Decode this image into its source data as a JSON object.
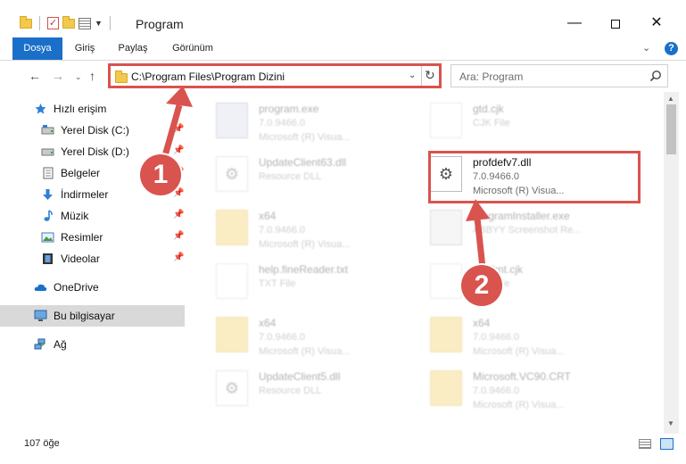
{
  "window": {
    "title": "Program",
    "minimize_glyph": "—",
    "close_glyph": "✕"
  },
  "ribbon": {
    "tabs": [
      {
        "label": "Dosya"
      },
      {
        "label": "Giriş"
      },
      {
        "label": "Paylaş"
      },
      {
        "label": "Görünüm"
      }
    ],
    "help_glyph": "?"
  },
  "navigation": {
    "address_path": "C:\\Program Files\\Program Dizini",
    "search_placeholder": "Ara: Program"
  },
  "sidebar": {
    "items": [
      {
        "label": "Hızlı erişim",
        "icon": "star-icon",
        "pinned": false
      },
      {
        "label": "Yerel Disk (C:)",
        "icon": "drive-icon",
        "pinned": true
      },
      {
        "label": "Yerel Disk (D:)",
        "icon": "drive-icon",
        "pinned": true
      },
      {
        "label": "Belgeler",
        "icon": "documents-icon",
        "pinned": true
      },
      {
        "label": "İndirmeler",
        "icon": "download-icon",
        "pinned": true
      },
      {
        "label": "Müzik",
        "icon": "music-icon",
        "pinned": true
      },
      {
        "label": "Resimler",
        "icon": "pictures-icon",
        "pinned": true
      },
      {
        "label": "Videolar",
        "icon": "video-icon",
        "pinned": true
      },
      {
        "label": "OneDrive",
        "icon": "cloud-icon",
        "pinned": false
      },
      {
        "label": "Bu bilgisayar",
        "icon": "computer-icon",
        "pinned": false,
        "selected": true
      },
      {
        "label": "Ağ",
        "icon": "network-icon",
        "pinned": false
      }
    ]
  },
  "files": [
    {
      "name": "program.exe",
      "line2": "7.0.9466.0",
      "line3": "Microsoft (R) Visua...",
      "icon": "exe-icon",
      "highlighted": false
    },
    {
      "name": "gtd.cjk",
      "line2": "CJK File",
      "line3": "",
      "icon": "document-icon",
      "highlighted": false
    },
    {
      "name": "UpdateClient63.dll",
      "line2": "Resource DLL",
      "line3": "",
      "icon": "dll-gear-icon",
      "highlighted": false
    },
    {
      "name": "profdefv7.dll",
      "line2": "7.0.9466.0",
      "line3": "Microsoft (R) Visua...",
      "icon": "dll-gear-icon",
      "highlighted": true
    },
    {
      "name": "x64",
      "line2": "7.0.9466.0",
      "line3": "Microsoft (R) Visua...",
      "icon": "folder-icon",
      "highlighted": false
    },
    {
      "name": "programInstaller.exe",
      "line2": "ABBYY Screenshot Re...",
      "line3": "",
      "icon": "installer-icon",
      "highlighted": false
    },
    {
      "name": "help.fineReader.txt",
      "line2": "TXT File",
      "line3": "",
      "icon": "document-icon",
      "highlighted": false
    },
    {
      "name": "chtfilmt.cjk",
      "line2": "CJK File",
      "line3": "",
      "icon": "document-icon",
      "highlighted": false
    },
    {
      "name": "x64",
      "line2": "7.0.9466.0",
      "line3": "Microsoft (R) Visua...",
      "icon": "folder-icon",
      "highlighted": false
    },
    {
      "name": "x64",
      "line2": "7.0.9466.0",
      "line3": "Microsoft (R) Visua...",
      "icon": "folder-icon",
      "highlighted": false
    },
    {
      "name": "UpdateClient5.dll",
      "line2": "Resource DLL",
      "line3": "",
      "icon": "dll-gear-icon",
      "highlighted": false
    },
    {
      "name": "Microsoft.VC90.CRT",
      "line2": "7.0.9466.0",
      "line3": "Microsoft (R) Visua...",
      "icon": "folder-icon",
      "highlighted": false
    }
  ],
  "callouts": [
    {
      "label": "1"
    },
    {
      "label": "2"
    }
  ],
  "status": {
    "item_count": "107 öğe"
  },
  "colors": {
    "accent": "#1a6fc9",
    "callout": "#d9534f",
    "selection": "#d9d9d9"
  }
}
